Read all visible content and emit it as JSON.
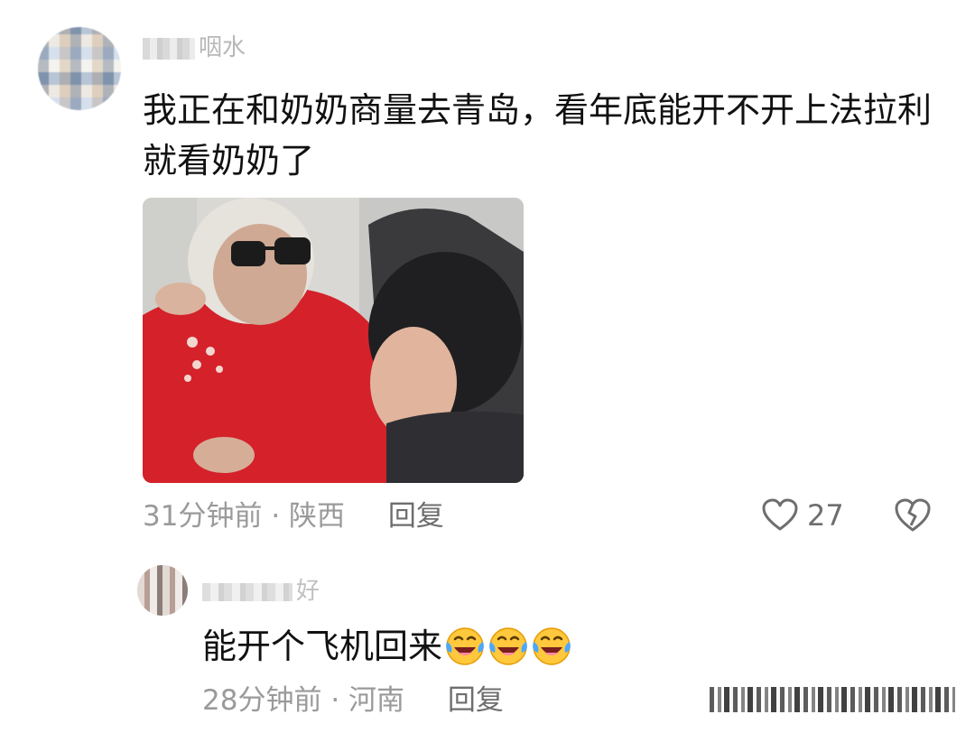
{
  "main_comment": {
    "username_visible": "咽水",
    "text_line1": "我正在和奶奶商量去青岛，看年底能开不开上法拉利",
    "text_line2": "就看奶奶了",
    "time": "31分钟前",
    "separator": "·",
    "location": "陕西",
    "reply_label": "回复",
    "like_count": "27"
  },
  "reply_comment": {
    "username_visible": "好",
    "text": "能开个飞机回来",
    "emoji": "face-with-tears-of-joy",
    "emoji_count": 3,
    "time": "28分钟前",
    "separator": "·",
    "location": "河南",
    "reply_label": "回复"
  },
  "colors": {
    "text_primary": "#111111",
    "text_meta": "#9a9a9a",
    "text_action": "#6e6e6e",
    "photo_sweater": "#d4212a"
  }
}
